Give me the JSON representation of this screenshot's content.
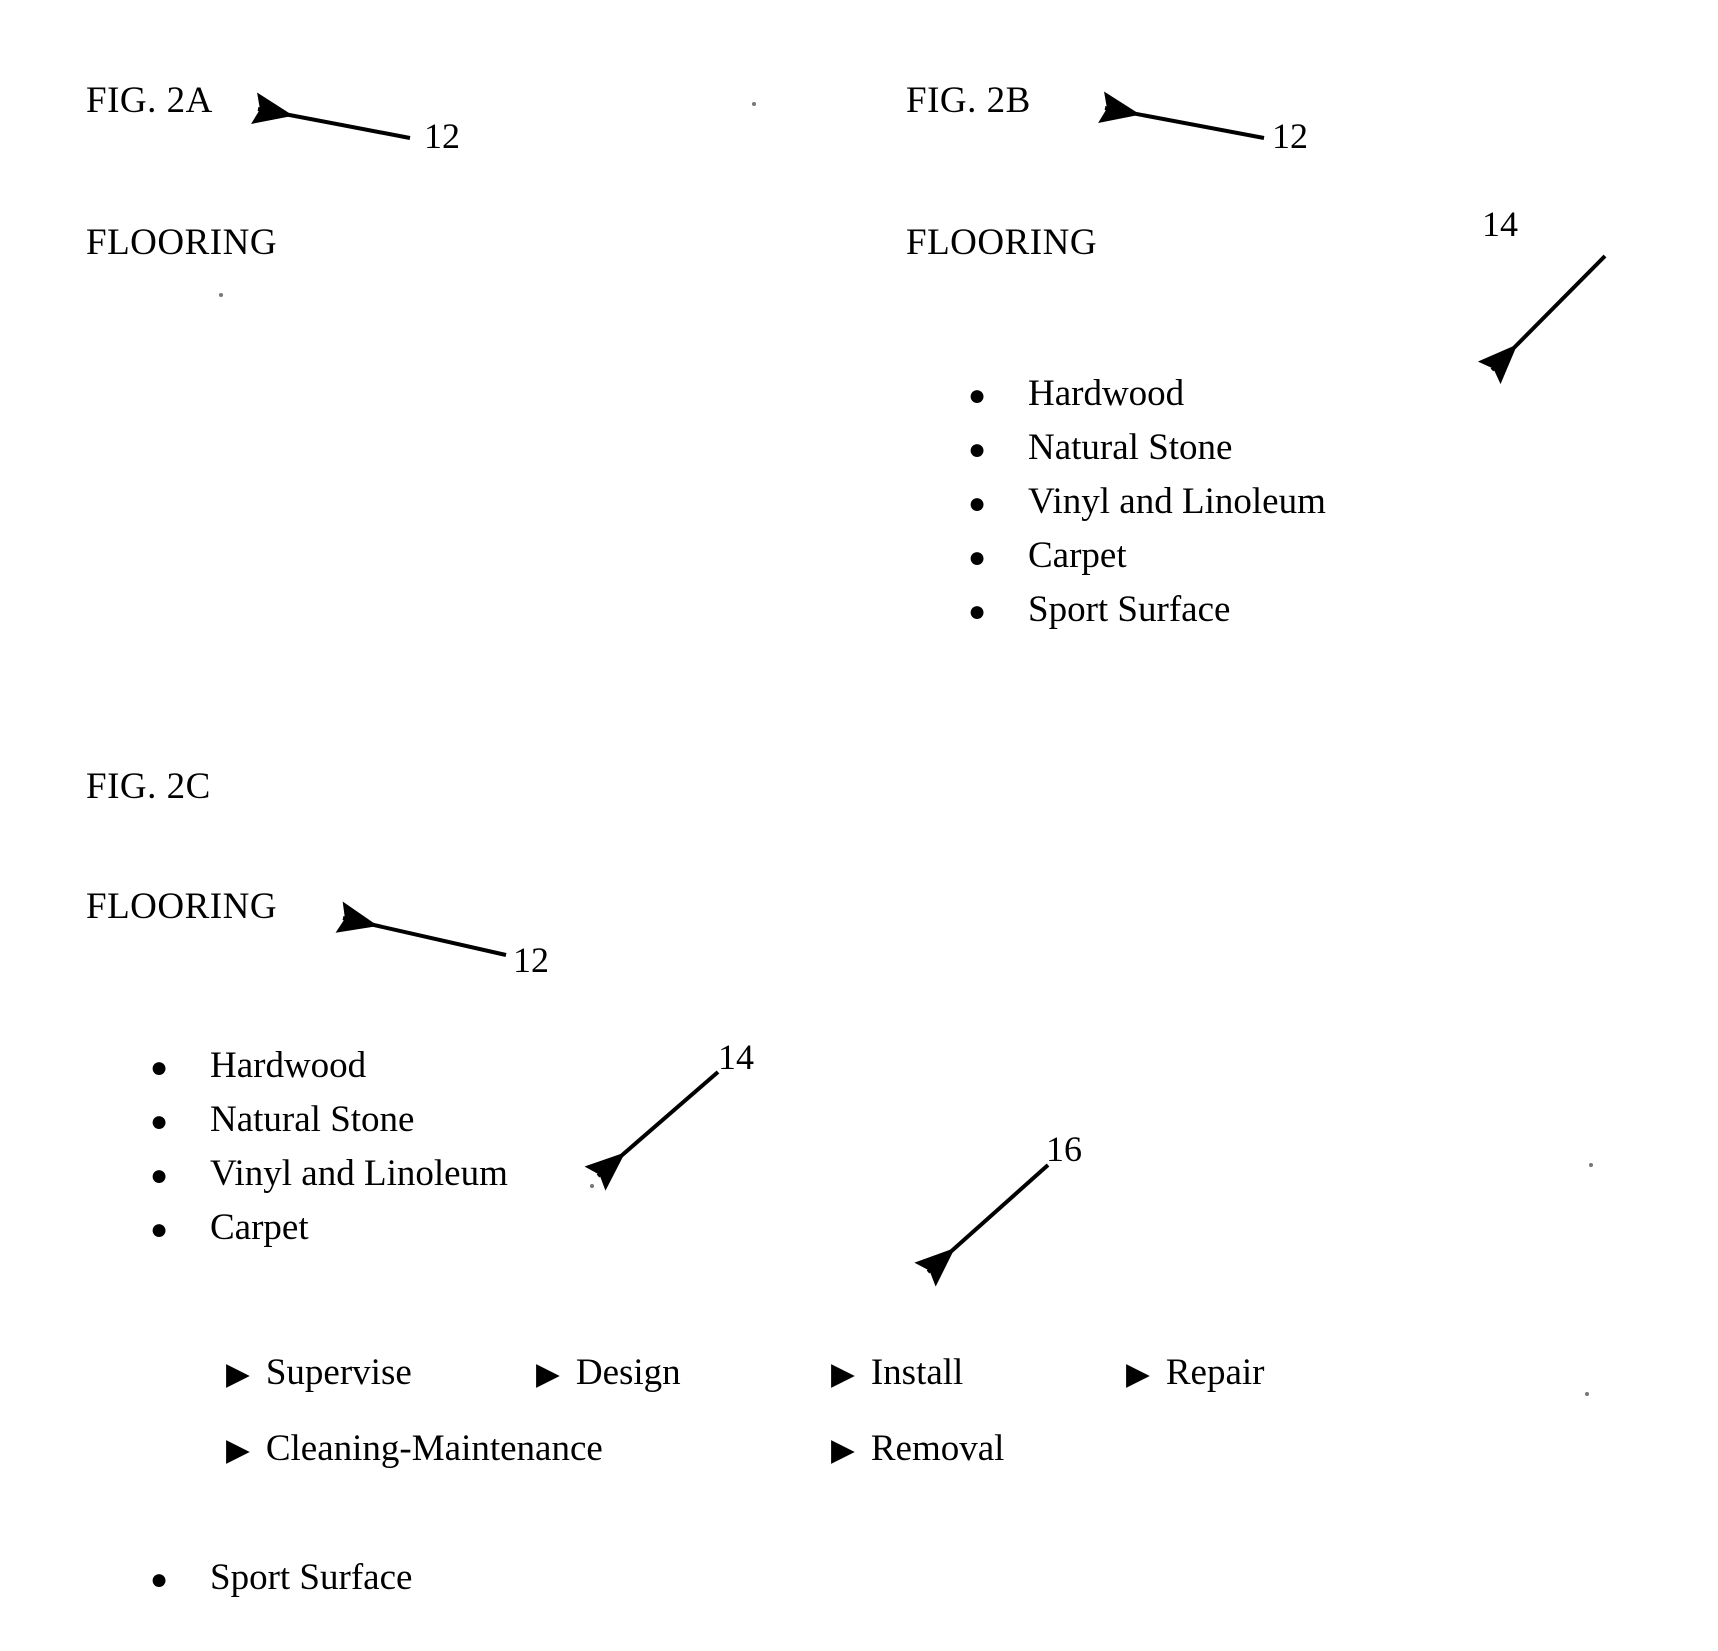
{
  "document": {
    "type": "patent-figure-sheet",
    "background_color": "#ffffff",
    "ink_color": "#000000"
  },
  "figures": [
    {
      "id": "fig-2a",
      "label": "FIG. 2A",
      "heading": "FLOORING",
      "reference_numerals": [
        {
          "id": "ref-12-a",
          "text": "12",
          "points_to": "heading"
        }
      ],
      "items": []
    },
    {
      "id": "fig-2b",
      "label": "FIG. 2B",
      "heading": "FLOORING",
      "reference_numerals": [
        {
          "id": "ref-12-b",
          "text": "12",
          "points_to": "heading"
        },
        {
          "id": "ref-14-b",
          "text": "14",
          "points_to": "list"
        }
      ],
      "items": [
        {
          "text": "Hardwood"
        },
        {
          "text": "Natural Stone"
        },
        {
          "text": "Vinyl and Linoleum"
        },
        {
          "text": "Carpet"
        },
        {
          "text": "Sport Surface"
        }
      ]
    },
    {
      "id": "fig-2c",
      "label": "FIG. 2C",
      "heading": "FLOORING",
      "reference_numerals": [
        {
          "id": "ref-12-c",
          "text": "12",
          "points_to": "heading"
        },
        {
          "id": "ref-14-c",
          "text": "14",
          "points_to": "list"
        },
        {
          "id": "ref-16-c",
          "text": "16",
          "points_to": "sub-items"
        }
      ],
      "items": [
        {
          "text": "Hardwood"
        },
        {
          "text": "Natural Stone"
        },
        {
          "text": "Vinyl and Linoleum"
        },
        {
          "text": "Carpet"
        },
        {
          "text": "Sport Surface"
        }
      ],
      "sub_items_rows": [
        [
          "Supervise",
          "Design",
          "Install",
          "Repair"
        ],
        [
          "Cleaning-Maintenance",
          "Removal"
        ]
      ]
    }
  ]
}
